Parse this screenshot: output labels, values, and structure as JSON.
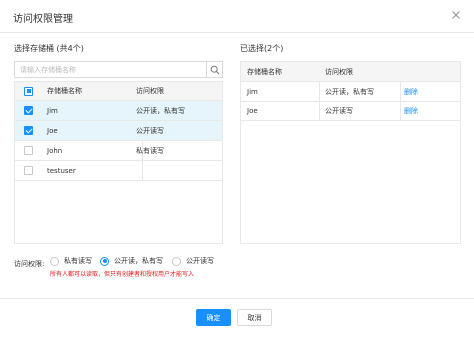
{
  "dialog": {
    "title": "访问权限管理",
    "close_icon": "close-icon"
  },
  "left": {
    "label": "选择存储桶 (共4个)",
    "search_placeholder": "请输入存储桶名称",
    "columns": [
      "存储桶名称",
      "访问权限"
    ],
    "rows": [
      {
        "name": "Jim",
        "permission": "公开读，私有写",
        "checked": true
      },
      {
        "name": "Joe",
        "permission": "公开读写",
        "checked": true
      },
      {
        "name": "John",
        "permission": "私有读写",
        "checked": false
      },
      {
        "name": "testuser",
        "permission": "",
        "checked": false
      }
    ]
  },
  "right": {
    "label": "已选择(2个)",
    "columns": [
      "存储桶名称",
      "访问权限",
      ""
    ],
    "rows": [
      {
        "name": "Jim",
        "permission": "公开读，私有写",
        "action": "删除"
      },
      {
        "name": "Joe",
        "permission": "公开读写",
        "action": "删除"
      }
    ]
  },
  "permission": {
    "label": "访问权限:",
    "options": [
      "私有读写",
      "公开读，私有写",
      "公开读写"
    ],
    "selected_index": 1,
    "warning": "所有人都可以读取，但只有创建者和授权用户才能写入"
  },
  "footer": {
    "ok_label": "确定",
    "cancel_label": "取消"
  },
  "colors": {
    "accent": "#1890ff",
    "selected_row": "#e6f4fb",
    "warning": "#e5161b"
  }
}
